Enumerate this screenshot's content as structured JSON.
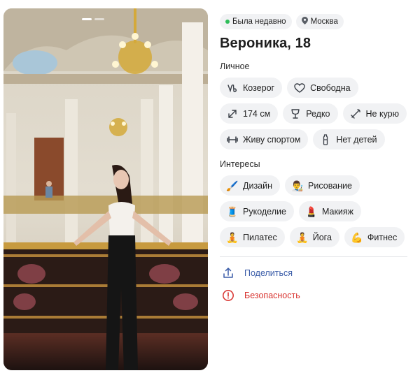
{
  "profile": {
    "status_text": "Была недавно",
    "city": "Москва",
    "name_age": "Вероника, 18"
  },
  "photo": {
    "pages_total": 2,
    "active_page": 1
  },
  "personal": {
    "title": "Личное",
    "chips": [
      {
        "icon": "capricorn-icon",
        "label": "Козерог"
      },
      {
        "icon": "heart-icon",
        "label": "Свободна"
      },
      {
        "icon": "height-icon",
        "label": "174 см"
      },
      {
        "icon": "glass-icon",
        "label": "Редко"
      },
      {
        "icon": "no-smoking-icon",
        "label": "Не курю"
      },
      {
        "icon": "dumbbell-icon",
        "label": "Живу спортом"
      },
      {
        "icon": "baby-bottle-icon",
        "label": "Нет детей"
      }
    ]
  },
  "interests": {
    "title": "Интересы",
    "chips": [
      {
        "icon": "brush-icon",
        "emoji": "🖌️",
        "label": "Дизайн"
      },
      {
        "icon": "artist-icon",
        "emoji": "👨‍🎨",
        "label": "Рисование"
      },
      {
        "icon": "thread-icon",
        "emoji": "🧵",
        "label": "Рукоделие"
      },
      {
        "icon": "lipstick-icon",
        "emoji": "💄",
        "label": "Макияж"
      },
      {
        "icon": "lotus-position-icon",
        "emoji": "🧘",
        "label": "Пилатес"
      },
      {
        "icon": "lotus-position-icon",
        "emoji": "🧘",
        "label": "Йога"
      },
      {
        "icon": "flexed-biceps-icon",
        "emoji": "💪",
        "label": "Фитнес"
      }
    ]
  },
  "actions": {
    "share_label": "Поделиться",
    "safety_label": "Безопасность"
  },
  "colors": {
    "online_dot": "#2ebd59",
    "link_blue": "#3a5ca8",
    "danger_red": "#d8322e",
    "chip_bg": "#f1f2f4"
  }
}
